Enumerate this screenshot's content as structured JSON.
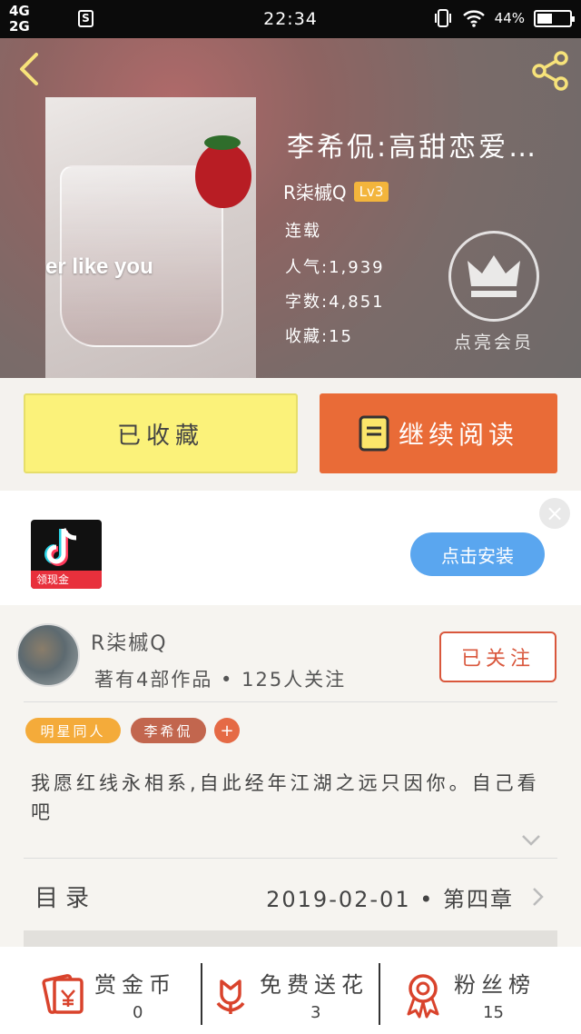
{
  "status_bar": {
    "net1": "4G",
    "net2": "2G",
    "s_icon": "S",
    "time": "22:34",
    "battery": "44%"
  },
  "header": {
    "title": "李希侃:高甜恋爱…",
    "author": "R柒槭Q",
    "level": "Lv3",
    "status": "连载",
    "popularity": "人气:1,939",
    "word_count": "字数:4,851",
    "favorites": "收藏:15",
    "vip_label": "点亮会员",
    "cover_text": "er like you"
  },
  "actions": {
    "collected_label": "已收藏",
    "continue_label": "继续阅读"
  },
  "ad": {
    "badge": "领现金",
    "install_label": "点击安装",
    "close": "×"
  },
  "author_card": {
    "name": "R柒槭Q",
    "stats": "著有4部作品 • 125人关注",
    "follow_label": "已关注",
    "tags": [
      "明星同人",
      "李希侃",
      "+"
    ],
    "description": "我愿红线永相系,自此经年江湖之远只因你。自己看吧"
  },
  "toc": {
    "label": "目录",
    "latest": "2019-02-01 • 第四章"
  },
  "bottom_bar": {
    "items": [
      {
        "label": "赏金币",
        "count": "0",
        "icon": "red-envelope-icon"
      },
      {
        "label": "免费送花",
        "count": "3",
        "icon": "flower-icon"
      },
      {
        "label": "粉丝榜",
        "count": "15",
        "icon": "medal-icon"
      }
    ]
  },
  "colors": {
    "accent_orange": "#e96b37",
    "collected_yellow": "#fbf27a",
    "install_blue": "#5aa6ef",
    "follow_red": "#d9573c"
  }
}
